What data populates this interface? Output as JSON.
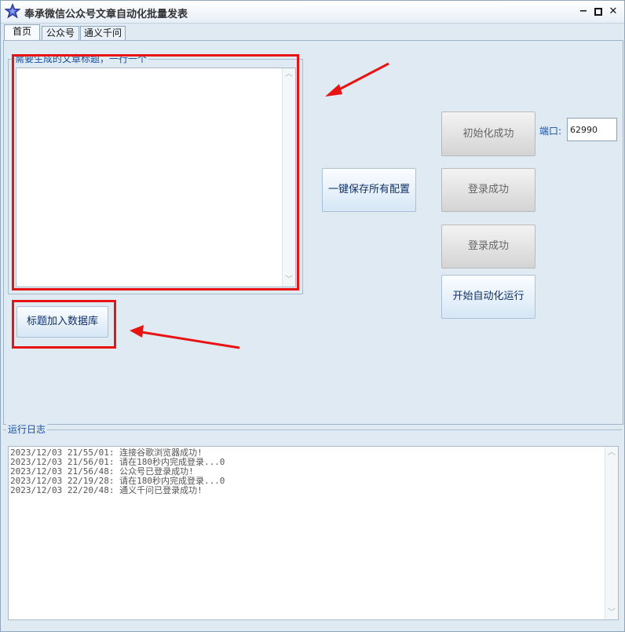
{
  "window": {
    "title": "奉承微信公众号文章自动化批量发表"
  },
  "tabs": [
    "首页",
    "公众号",
    "通义千问"
  ],
  "titles_group": {
    "label": "需要生成的文章标题，一行一个",
    "content": ""
  },
  "buttons": {
    "save_all": "一键保存所有配置",
    "init": "初始化成功",
    "login1": "登录成功",
    "login2": "登录成功",
    "start": "开始自动化运行",
    "add_titles": "标题加入数据库"
  },
  "port": {
    "label": "端口:",
    "value": "62990"
  },
  "log": {
    "label": "运行日志",
    "lines": [
      "2023/12/03 21/55/01: 连接谷歌浏览器成功!",
      "2023/12/03 21/56/01: 请在180秒内完成登录...0",
      "2023/12/03 21/56/48: 公众号已登录成功!",
      "2023/12/03 22/19/28: 请在180秒内完成登录...0",
      "2023/12/03 22/20/48: 通义千问已登录成功!"
    ]
  },
  "colors": {
    "annotation": "#e81414",
    "accent": "#1a4fa0"
  },
  "icons": {
    "app": "star-icon",
    "minimize": "minimize-icon",
    "maximize": "maximize-icon",
    "close": "close-icon"
  }
}
